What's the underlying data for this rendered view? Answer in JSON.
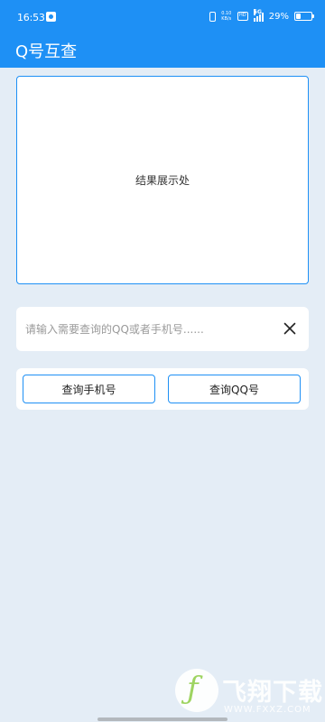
{
  "status_bar": {
    "time": "16:53",
    "speed": "0.10 KB/s",
    "hd": "HD",
    "network": "5G",
    "battery": "29%",
    "battery_level": 0.29
  },
  "app_bar": {
    "title": "Q号互查",
    "color": "#1e90f5"
  },
  "result": {
    "placeholder": "结果展示处"
  },
  "search": {
    "placeholder": "请输入需要查询的QQ或者手机号......",
    "value": "",
    "clear_icon": "close-icon"
  },
  "actions": {
    "query_phone_label": "查询手机号",
    "query_qq_label": "查询QQ号"
  },
  "watermark": {
    "text": "飞翔下载",
    "url": "WWW.FXXZ.COM"
  }
}
